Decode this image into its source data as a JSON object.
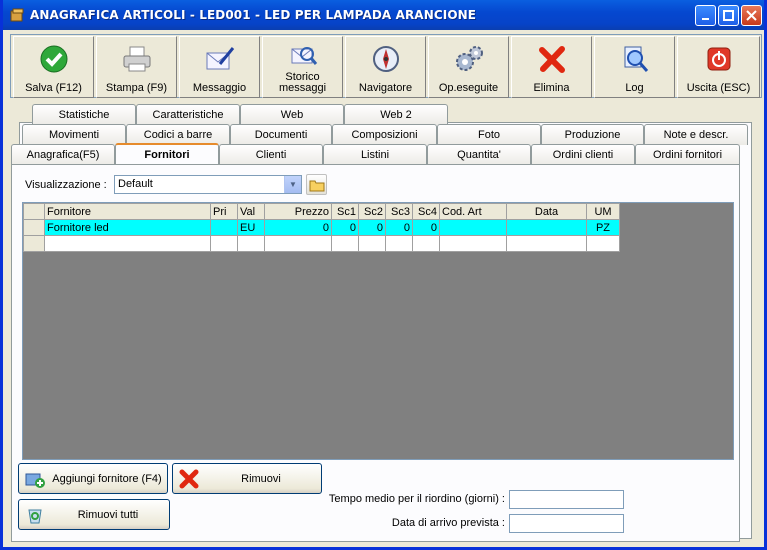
{
  "window": {
    "title": "ANAGRAFICA ARTICOLI - LED001 - LED PER LAMPADA ARANCIONE"
  },
  "toolbar": [
    {
      "label": "Salva (F12)",
      "icon": "check-icon"
    },
    {
      "label": "Stampa (F9)",
      "icon": "printer-icon"
    },
    {
      "label": "Messaggio",
      "icon": "envelope-pen-icon"
    },
    {
      "label": "Storico\nmessaggi",
      "icon": "message-history-icon"
    },
    {
      "label": "Navigatore",
      "icon": "compass-icon"
    },
    {
      "label": "Op.eseguite",
      "icon": "gears-icon"
    },
    {
      "label": "Elimina",
      "icon": "delete-x-icon"
    },
    {
      "label": "Log",
      "icon": "log-magnifier-icon"
    },
    {
      "label": "Uscita (ESC)",
      "icon": "exit-power-icon"
    }
  ],
  "tabs": {
    "row1": [
      "Statistiche",
      "Caratteristiche",
      "Web",
      "Web 2"
    ],
    "row2": [
      "Movimenti",
      "Codici a barre",
      "Documenti",
      "Composizioni",
      "Foto",
      "Produzione",
      "Note e descr."
    ],
    "row3": [
      "Anagrafica(F5)",
      "Fornitori",
      "Clienti",
      "Listini",
      "Quantita'",
      "Ordini clienti",
      "Ordini fornitori"
    ],
    "active": "Fornitori"
  },
  "view": {
    "label": "Visualizzazione :",
    "value": "Default"
  },
  "grid": {
    "columns": [
      "Fornitore",
      "Pri",
      "Val",
      "Prezzo",
      "Sc1",
      "Sc2",
      "Sc3",
      "Sc4",
      "Cod. Art",
      "Data",
      "UM"
    ],
    "rows": [
      [
        "Fornitore led",
        "",
        "EU",
        "0",
        "0",
        "0",
        "0",
        "0",
        "",
        "",
        "PZ"
      ]
    ]
  },
  "buttons": {
    "add": "Aggiungi fornitore (F4)",
    "remove": "Rimuovi",
    "remove_all": "Rimuovi tutti"
  },
  "fields": {
    "reorder_label": "Tempo medio per il riordino (giorni) :",
    "reorder_value": "",
    "arrival_label": "Data di arrivo prevista :",
    "arrival_value": ""
  }
}
